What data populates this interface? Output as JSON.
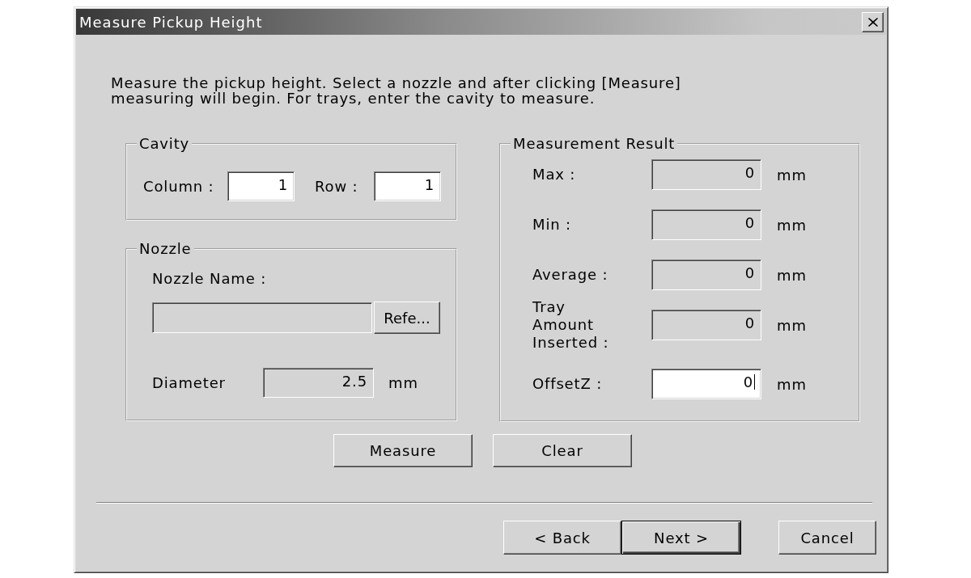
{
  "window": {
    "title": "Measure Pickup Height"
  },
  "description": "Measure the pickup height. Select a nozzle and after clicking [Measure] measuring will begin. For trays, enter the cavity to measure.",
  "cavity": {
    "title": "Cavity",
    "fields": [
      {
        "label": "Column :",
        "value": "1",
        "read_only": false
      },
      {
        "label": "Row :",
        "value": "1",
        "read_only": false
      }
    ]
  },
  "nozzle": {
    "title": "Nozzle",
    "name_label": "Nozzle Name :",
    "name_field": {
      "read_only": true
    },
    "reference_button": "Refe...",
    "diameter": {
      "label": "Diameter",
      "value": "2.5",
      "unit": "mm",
      "read_only": true
    }
  },
  "measurement": {
    "title": "Measurement Result",
    "rows": [
      {
        "label": "Max :",
        "value": "0",
        "unit": "mm",
        "read_only": true,
        "focused": false
      },
      {
        "label": "Min :",
        "value": "0",
        "unit": "mm",
        "read_only": true,
        "focused": false
      },
      {
        "label": "Average :",
        "value": "0",
        "unit": "mm",
        "read_only": true,
        "focused": false
      },
      {
        "label": "Tray Amount Inserted :",
        "value": "0",
        "unit": "mm",
        "read_only": true,
        "focused": false
      },
      {
        "label": "OffsetZ :",
        "value": "0",
        "unit": "mm",
        "read_only": false,
        "focused": true
      }
    ]
  },
  "actions": [
    "Measure",
    "Clear"
  ],
  "footer_buttons": [
    {
      "label": "< Back",
      "default": false
    },
    {
      "label": "Next >",
      "default": true
    },
    {
      "label": "Cancel",
      "default": false
    }
  ]
}
